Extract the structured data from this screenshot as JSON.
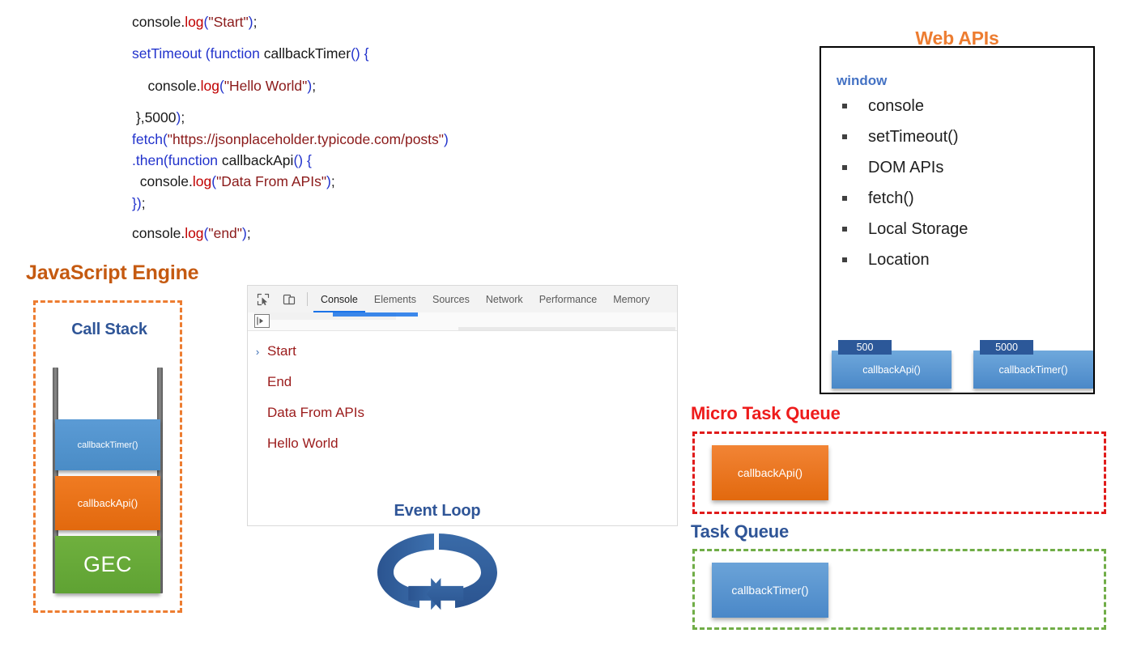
{
  "code": {
    "lines": [
      [
        {
          "t": "console.",
          "c": "plain"
        },
        {
          "t": "log",
          "c": "fn"
        },
        {
          "t": "(",
          "c": "kw"
        },
        {
          "t": "\"Start\"",
          "c": "str"
        },
        {
          "t": ")",
          "c": "kw"
        },
        {
          "t": ";",
          "c": "plain"
        }
      ],
      [
        {
          "t": "setTimeout (function ",
          "c": "kw"
        },
        {
          "t": "callbackTimer",
          "c": "plain"
        },
        {
          "t": "() {",
          "c": "kw"
        }
      ],
      [
        {
          "t": "    console.",
          "c": "plain"
        },
        {
          "t": "log",
          "c": "fn"
        },
        {
          "t": "(",
          "c": "kw"
        },
        {
          "t": "\"Hello World\"",
          "c": "str"
        },
        {
          "t": ")",
          "c": "kw"
        },
        {
          "t": ";",
          "c": "plain"
        }
      ],
      [
        {
          "t": " },5000",
          "c": "plain"
        },
        {
          "t": ")",
          "c": "kw"
        },
        {
          "t": ";",
          "c": "plain"
        }
      ],
      [
        {
          "t": "fetch(",
          "c": "kw"
        },
        {
          "t": "\"https://jsonplaceholder.typicode.com/posts\"",
          "c": "str"
        },
        {
          "t": ")",
          "c": "kw"
        }
      ],
      [
        {
          "t": ".then(function ",
          "c": "kw"
        },
        {
          "t": "callbackApi",
          "c": "plain"
        },
        {
          "t": "() {",
          "c": "kw"
        }
      ],
      [
        {
          "t": "  console.",
          "c": "plain"
        },
        {
          "t": "log",
          "c": "fn"
        },
        {
          "t": "(",
          "c": "kw"
        },
        {
          "t": "\"Data From APIs\"",
          "c": "str"
        },
        {
          "t": ")",
          "c": "kw"
        },
        {
          "t": ";",
          "c": "plain"
        }
      ],
      [
        {
          "t": "})",
          "c": "kw"
        },
        {
          "t": ";",
          "c": "plain"
        }
      ],
      [
        {
          "t": "console.",
          "c": "plain"
        },
        {
          "t": "log",
          "c": "fn"
        },
        {
          "t": "(",
          "c": "kw"
        },
        {
          "t": "\"end\"",
          "c": "str"
        },
        {
          "t": ")",
          "c": "kw"
        },
        {
          "t": ";",
          "c": "plain"
        }
      ]
    ]
  },
  "js_engine": {
    "title": "JavaScript Engine",
    "call_stack": {
      "title": "Call Stack",
      "frames": [
        {
          "label": "callbackTimer()",
          "color": "#5B9BD5"
        },
        {
          "label": "callbackApi()",
          "color": "#F07B22"
        },
        {
          "label": "GEC",
          "color": "#6FB03E"
        }
      ]
    }
  },
  "devtools": {
    "icons": [
      "inspect-element-icon",
      "device-toolbar-icon",
      "frame-filter-icon"
    ],
    "tabs": [
      {
        "label": "Console",
        "active": true
      },
      {
        "label": "Elements",
        "active": false
      },
      {
        "label": "Sources",
        "active": false
      },
      {
        "label": "Network",
        "active": false
      },
      {
        "label": "Performance",
        "active": false
      },
      {
        "label": "Memory",
        "active": false
      }
    ],
    "console_lines": [
      {
        "text": "Start",
        "caret": "›"
      },
      {
        "text": "End",
        "caret": ""
      },
      {
        "text": "Data From APIs",
        "caret": ""
      },
      {
        "text": "Hello World",
        "caret": ""
      }
    ]
  },
  "event_loop": {
    "title": "Event Loop",
    "icon": "circular-arrow-loop-icon",
    "color": "#2F5597"
  },
  "web_apis": {
    "title": "Web APIs",
    "window_label": "window",
    "items": [
      "console",
      "setTimeout()",
      "DOM APIs",
      "fetch()",
      "Local Storage",
      "Location"
    ],
    "timers": [
      {
        "delay": "500",
        "callback": "callbackApi()"
      },
      {
        "delay": "5000",
        "callback": "callbackTimer()"
      }
    ]
  },
  "micro_task_queue": {
    "title": "Micro Task Queue",
    "items": [
      {
        "label": "callbackApi()"
      }
    ]
  },
  "task_queue": {
    "title": "Task Queue",
    "items": [
      {
        "label": "callbackTimer()"
      }
    ]
  },
  "colors": {
    "js_engine_orange": "#C55A11",
    "web_apis_orange": "#ED7D31",
    "navy": "#2F5597",
    "red": "#EE1C1C",
    "green_dash": "#70AD47",
    "console_text": "#9B1B1B",
    "window_blue": "#4472C4"
  }
}
